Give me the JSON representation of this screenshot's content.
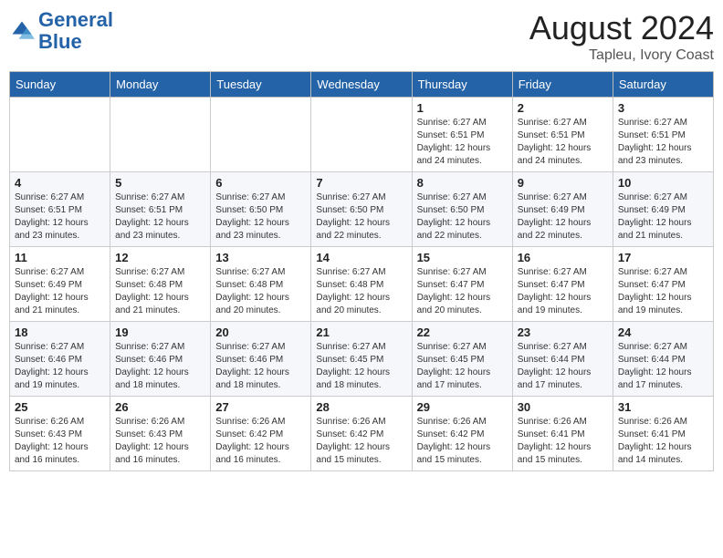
{
  "logo": {
    "line1": "General",
    "line2": "Blue"
  },
  "title": "August 2024",
  "location": "Tapleu, Ivory Coast",
  "days_of_week": [
    "Sunday",
    "Monday",
    "Tuesday",
    "Wednesday",
    "Thursday",
    "Friday",
    "Saturday"
  ],
  "weeks": [
    [
      {
        "day": "",
        "info": ""
      },
      {
        "day": "",
        "info": ""
      },
      {
        "day": "",
        "info": ""
      },
      {
        "day": "",
        "info": ""
      },
      {
        "day": "1",
        "info": "Sunrise: 6:27 AM\nSunset: 6:51 PM\nDaylight: 12 hours\nand 24 minutes."
      },
      {
        "day": "2",
        "info": "Sunrise: 6:27 AM\nSunset: 6:51 PM\nDaylight: 12 hours\nand 24 minutes."
      },
      {
        "day": "3",
        "info": "Sunrise: 6:27 AM\nSunset: 6:51 PM\nDaylight: 12 hours\nand 23 minutes."
      }
    ],
    [
      {
        "day": "4",
        "info": "Sunrise: 6:27 AM\nSunset: 6:51 PM\nDaylight: 12 hours\nand 23 minutes."
      },
      {
        "day": "5",
        "info": "Sunrise: 6:27 AM\nSunset: 6:51 PM\nDaylight: 12 hours\nand 23 minutes."
      },
      {
        "day": "6",
        "info": "Sunrise: 6:27 AM\nSunset: 6:50 PM\nDaylight: 12 hours\nand 23 minutes."
      },
      {
        "day": "7",
        "info": "Sunrise: 6:27 AM\nSunset: 6:50 PM\nDaylight: 12 hours\nand 22 minutes."
      },
      {
        "day": "8",
        "info": "Sunrise: 6:27 AM\nSunset: 6:50 PM\nDaylight: 12 hours\nand 22 minutes."
      },
      {
        "day": "9",
        "info": "Sunrise: 6:27 AM\nSunset: 6:49 PM\nDaylight: 12 hours\nand 22 minutes."
      },
      {
        "day": "10",
        "info": "Sunrise: 6:27 AM\nSunset: 6:49 PM\nDaylight: 12 hours\nand 21 minutes."
      }
    ],
    [
      {
        "day": "11",
        "info": "Sunrise: 6:27 AM\nSunset: 6:49 PM\nDaylight: 12 hours\nand 21 minutes."
      },
      {
        "day": "12",
        "info": "Sunrise: 6:27 AM\nSunset: 6:48 PM\nDaylight: 12 hours\nand 21 minutes."
      },
      {
        "day": "13",
        "info": "Sunrise: 6:27 AM\nSunset: 6:48 PM\nDaylight: 12 hours\nand 20 minutes."
      },
      {
        "day": "14",
        "info": "Sunrise: 6:27 AM\nSunset: 6:48 PM\nDaylight: 12 hours\nand 20 minutes."
      },
      {
        "day": "15",
        "info": "Sunrise: 6:27 AM\nSunset: 6:47 PM\nDaylight: 12 hours\nand 20 minutes."
      },
      {
        "day": "16",
        "info": "Sunrise: 6:27 AM\nSunset: 6:47 PM\nDaylight: 12 hours\nand 19 minutes."
      },
      {
        "day": "17",
        "info": "Sunrise: 6:27 AM\nSunset: 6:47 PM\nDaylight: 12 hours\nand 19 minutes."
      }
    ],
    [
      {
        "day": "18",
        "info": "Sunrise: 6:27 AM\nSunset: 6:46 PM\nDaylight: 12 hours\nand 19 minutes."
      },
      {
        "day": "19",
        "info": "Sunrise: 6:27 AM\nSunset: 6:46 PM\nDaylight: 12 hours\nand 18 minutes."
      },
      {
        "day": "20",
        "info": "Sunrise: 6:27 AM\nSunset: 6:46 PM\nDaylight: 12 hours\nand 18 minutes."
      },
      {
        "day": "21",
        "info": "Sunrise: 6:27 AM\nSunset: 6:45 PM\nDaylight: 12 hours\nand 18 minutes."
      },
      {
        "day": "22",
        "info": "Sunrise: 6:27 AM\nSunset: 6:45 PM\nDaylight: 12 hours\nand 17 minutes."
      },
      {
        "day": "23",
        "info": "Sunrise: 6:27 AM\nSunset: 6:44 PM\nDaylight: 12 hours\nand 17 minutes."
      },
      {
        "day": "24",
        "info": "Sunrise: 6:27 AM\nSunset: 6:44 PM\nDaylight: 12 hours\nand 17 minutes."
      }
    ],
    [
      {
        "day": "25",
        "info": "Sunrise: 6:26 AM\nSunset: 6:43 PM\nDaylight: 12 hours\nand 16 minutes."
      },
      {
        "day": "26",
        "info": "Sunrise: 6:26 AM\nSunset: 6:43 PM\nDaylight: 12 hours\nand 16 minutes."
      },
      {
        "day": "27",
        "info": "Sunrise: 6:26 AM\nSunset: 6:42 PM\nDaylight: 12 hours\nand 16 minutes."
      },
      {
        "day": "28",
        "info": "Sunrise: 6:26 AM\nSunset: 6:42 PM\nDaylight: 12 hours\nand 15 minutes."
      },
      {
        "day": "29",
        "info": "Sunrise: 6:26 AM\nSunset: 6:42 PM\nDaylight: 12 hours\nand 15 minutes."
      },
      {
        "day": "30",
        "info": "Sunrise: 6:26 AM\nSunset: 6:41 PM\nDaylight: 12 hours\nand 15 minutes."
      },
      {
        "day": "31",
        "info": "Sunrise: 6:26 AM\nSunset: 6:41 PM\nDaylight: 12 hours\nand 14 minutes."
      }
    ]
  ]
}
